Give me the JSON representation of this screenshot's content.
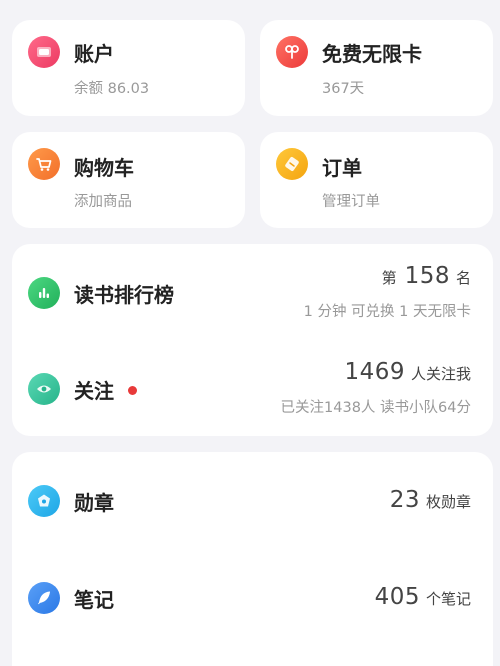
{
  "tiles": {
    "account": {
      "title": "账户",
      "sub": "余额 86.03",
      "icon": "wallet-icon",
      "color": "#f0506e"
    },
    "free_card": {
      "title": "免费无限卡",
      "sub": "367天",
      "icon": "key-icon",
      "color": "#f05050"
    },
    "cart": {
      "title": "购物车",
      "sub": "添加商品",
      "icon": "cart-icon",
      "color": "#f58a3c"
    },
    "orders": {
      "title": "订单",
      "sub": "管理订单",
      "icon": "ticket-icon",
      "color": "#f7b21f"
    }
  },
  "ranking": {
    "label": "读书排行榜",
    "prefix": "第",
    "value": "158",
    "unit": "名",
    "sub": "1 分钟 可兑换 1 天无限卡",
    "icon": "bar-chart-icon",
    "color": "#34c46a"
  },
  "follow": {
    "label": "关注",
    "value": "1469",
    "unit": "人关注我",
    "sub": "已关注1438人 读书小队64分",
    "icon": "eye-icon",
    "color": "#3cc4a0",
    "badge_color": "#e83a3a"
  },
  "medals": {
    "label": "勋章",
    "value": "23",
    "unit": "枚勋章",
    "icon": "medal-icon",
    "color": "#2fb7f0"
  },
  "notes": {
    "label": "笔记",
    "value": "405",
    "unit": "个笔记",
    "icon": "feather-icon",
    "color": "#3a8cf0"
  }
}
